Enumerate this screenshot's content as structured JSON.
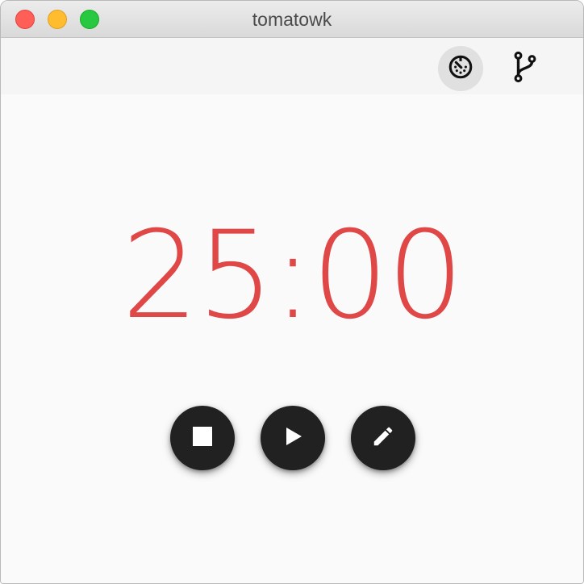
{
  "window": {
    "title": "tomatowk"
  },
  "toolbar": {
    "timer_icon": "timer-icon",
    "branch_icon": "source-branch-icon"
  },
  "timer": {
    "display": "25:00",
    "color": "#e04848"
  },
  "controls": {
    "stop_icon": "stop-icon",
    "play_icon": "play-icon",
    "edit_icon": "pencil-icon"
  }
}
